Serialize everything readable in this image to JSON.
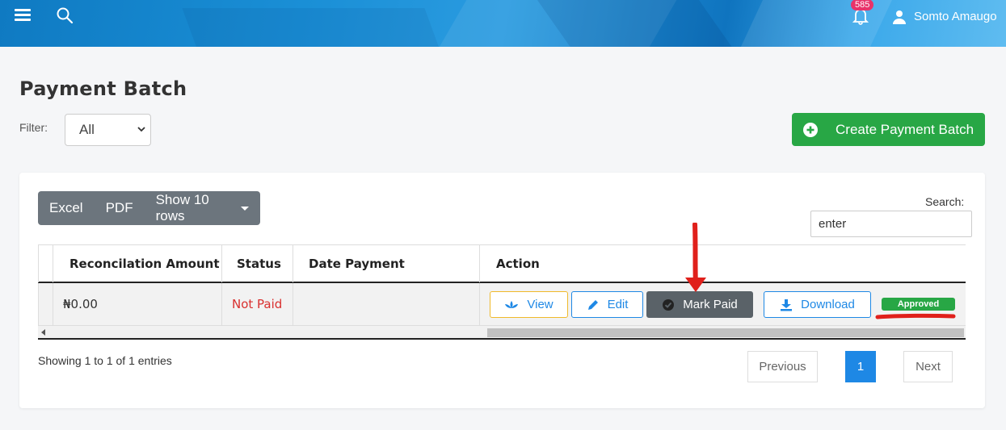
{
  "header": {
    "notification_count": "585",
    "user_name": "Somto Amaugo"
  },
  "page": {
    "title": "Payment Batch",
    "filter_label": "Filter:",
    "filter_value": "All",
    "create_button": "Create Payment Batch"
  },
  "toolbar": {
    "excel": "Excel",
    "pdf": "PDF",
    "show_rows": "Show 10 rows",
    "search_label": "Search:",
    "search_value": "enter"
  },
  "table": {
    "columns": [
      "Reconcilation Amount",
      "Status",
      "Date Payment Completed",
      "Action"
    ],
    "rows": [
      {
        "reconciliation_amount": "₦0.00",
        "status": "Not Paid",
        "date_payment_completed": "",
        "actions": {
          "view": "View",
          "edit": "Edit",
          "mark_paid": "Mark Paid",
          "download": "Download",
          "approval_badge": "Approved"
        }
      }
    ]
  },
  "footer": {
    "info": "Showing 1 to 1 of 1 entries",
    "previous": "Previous",
    "current_page": "1",
    "next": "Next"
  },
  "colors": {
    "primary": "#1e88e5",
    "success": "#28a745",
    "danger": "#d9302f",
    "secondary": "#6c757d",
    "annotation": "#e0201b"
  }
}
